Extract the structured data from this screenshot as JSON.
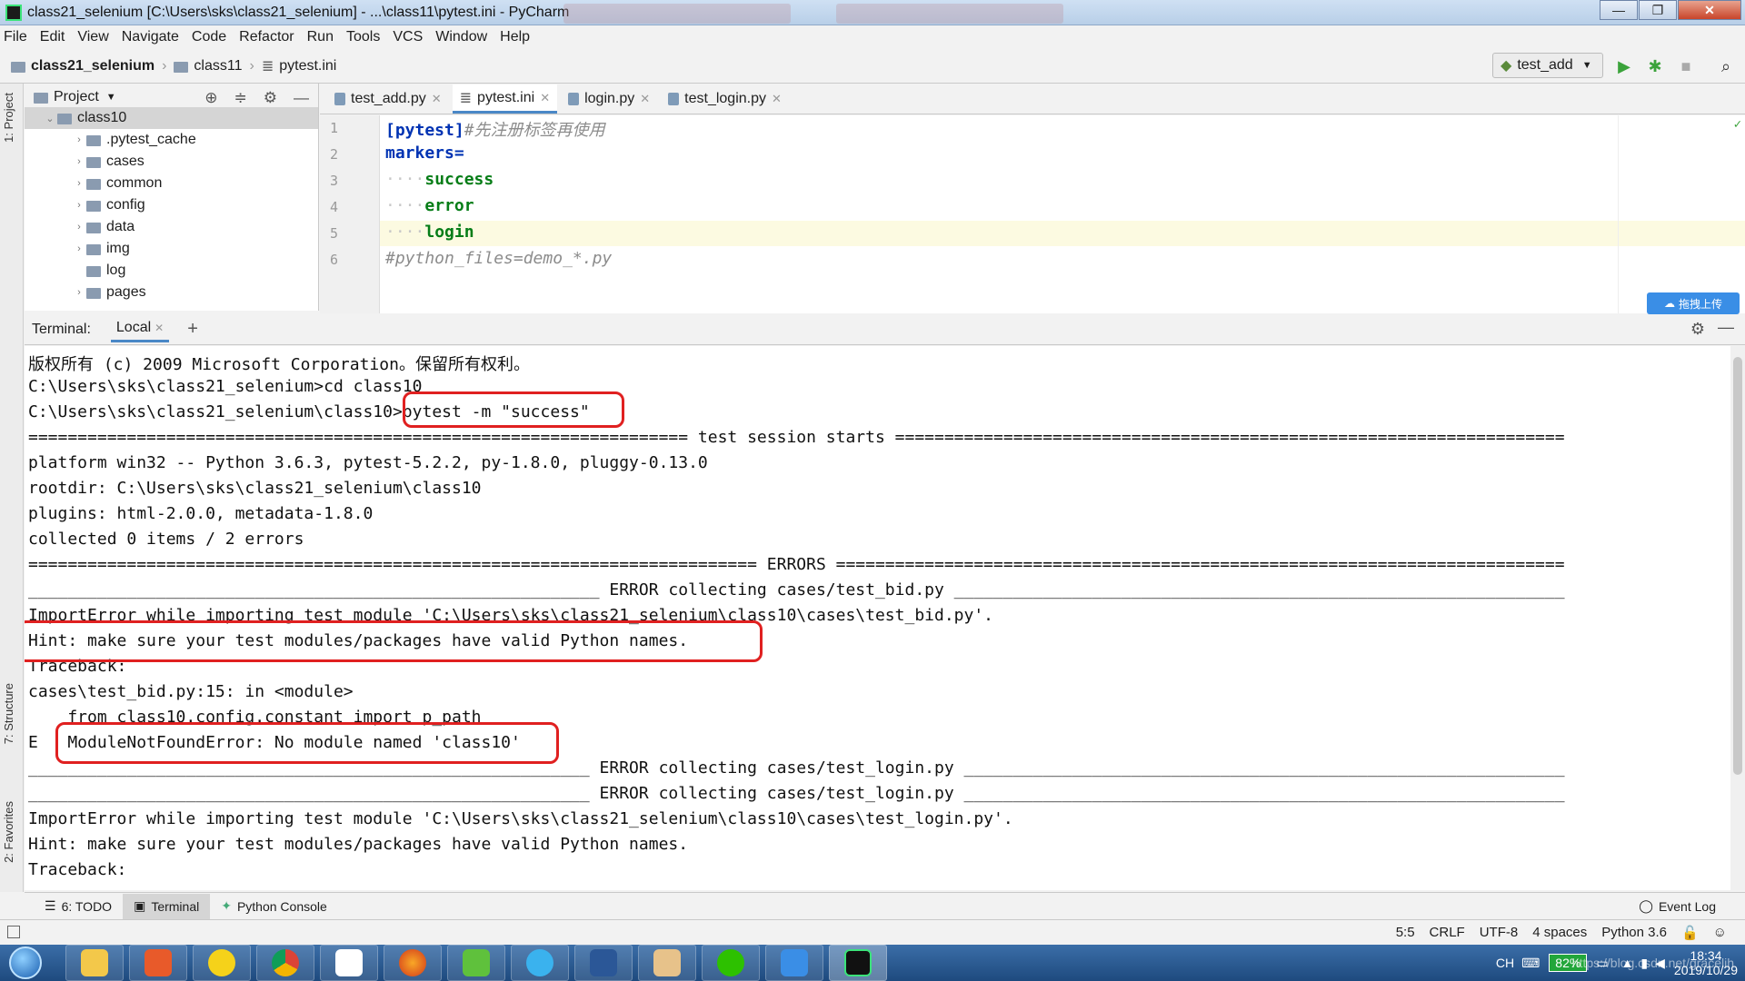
{
  "window": {
    "title": "class21_selenium [C:\\Users\\sks\\class21_selenium] - ...\\class11\\pytest.ini - PyCharm",
    "minimize": "—",
    "maximize": "❐",
    "close": "✕"
  },
  "menu": [
    "File",
    "Edit",
    "View",
    "Navigate",
    "Code",
    "Refactor",
    "Run",
    "Tools",
    "VCS",
    "Window",
    "Help"
  ],
  "breadcrumb": {
    "project": "class21_selenium",
    "folder": "class11",
    "file": "pytest.ini"
  },
  "run_config": {
    "name": "test_add"
  },
  "left_strip": {
    "project_tab": "1: Project",
    "structure_tab": "7: Structure",
    "favorites_tab": "2: Favorites"
  },
  "project_panel": {
    "title": "Project",
    "items": [
      {
        "label": "class10",
        "level": 0,
        "expanded": true,
        "selected": true
      },
      {
        "label": ".pytest_cache",
        "level": 1
      },
      {
        "label": "cases",
        "level": 1
      },
      {
        "label": "common",
        "level": 1
      },
      {
        "label": "config",
        "level": 1
      },
      {
        "label": "data",
        "level": 1
      },
      {
        "label": "img",
        "level": 1
      },
      {
        "label": "log",
        "level": 1
      },
      {
        "label": "pages",
        "level": 1
      }
    ]
  },
  "editor_tabs": [
    {
      "label": "test_add.py",
      "active": false
    },
    {
      "label": "pytest.ini",
      "active": true
    },
    {
      "label": "login.py",
      "active": false
    },
    {
      "label": "test_login.py",
      "active": false
    }
  ],
  "editor": {
    "line_numbers": [
      "1",
      "2",
      "3",
      "4",
      "5",
      "6"
    ],
    "line1_section": "[pytest]",
    "line1_comment": "#先注册标签再使用",
    "line2": "markers=",
    "line3": "success",
    "line4": "error",
    "line5": "login",
    "line6": "#python_files=demo_*.py",
    "indent": "····"
  },
  "upload_button": "拖拽上传",
  "terminal": {
    "label": "Terminal:",
    "tab": "Local",
    "lines": [
      "版权所有 (c) 2009 Microsoft Corporation。保留所有权利。",
      "C:\\Users\\sks\\class21_selenium>cd class10",
      "C:\\Users\\sks\\class21_selenium\\class10>pytest -m \"success\"",
      "=================================================================== test session starts ====================================================================",
      "platform win32 -- Python 3.6.3, pytest-5.2.2, py-1.8.0, pluggy-0.13.0",
      "rootdir: C:\\Users\\sks\\class21_selenium\\class10",
      "plugins: html-2.0.0, metadata-1.8.0",
      "collected 0 items / 2 errors",
      "========================================================================== ERRORS ==========================================================================",
      "__________________________________________________________ ERROR collecting cases/test_bid.py ______________________________________________________________",
      "ImportError while importing test module 'C:\\Users\\sks\\class21_selenium\\class10\\cases\\test_bid.py'.",
      "Hint: make sure your test modules/packages have valid Python names.",
      "Traceback:",
      "cases\\test_bid.py:15: in <module>",
      "    from class10.config.constant import p_path",
      "E   ModuleNotFoundError: No module named 'class10'",
      "_________________________________________________________ ERROR collecting cases/test_login.py _____________________________________________________________",
      "_________________________________________________________ ERROR collecting cases/test_login.py _____________________________________________________________",
      "ImportError while importing test module 'C:\\Users\\sks\\class21_selenium\\class10\\cases\\test_login.py'.",
      "Hint: make sure your test modules/packages have valid Python names.",
      "Traceback:"
    ]
  },
  "bottom_tabs": [
    {
      "label": "6: TODO",
      "active": false
    },
    {
      "label": "Terminal",
      "active": true
    },
    {
      "label": "Python Console",
      "active": false
    }
  ],
  "event_log": "Event Log",
  "status": {
    "position": "5:5",
    "line_sep": "CRLF",
    "encoding": "UTF-8",
    "indent": "4 spaces",
    "interpreter": "Python 3.6"
  },
  "taskbar": {
    "lang": "CH",
    "battery": "82%",
    "time": "18:34",
    "date": "2019/10/29",
    "watermark": "https://blog.csdn.net/gracelih"
  },
  "colors": {
    "accent": "#4a88c7",
    "red_box": "#e02020",
    "taskbar": "#1e4a7e"
  }
}
